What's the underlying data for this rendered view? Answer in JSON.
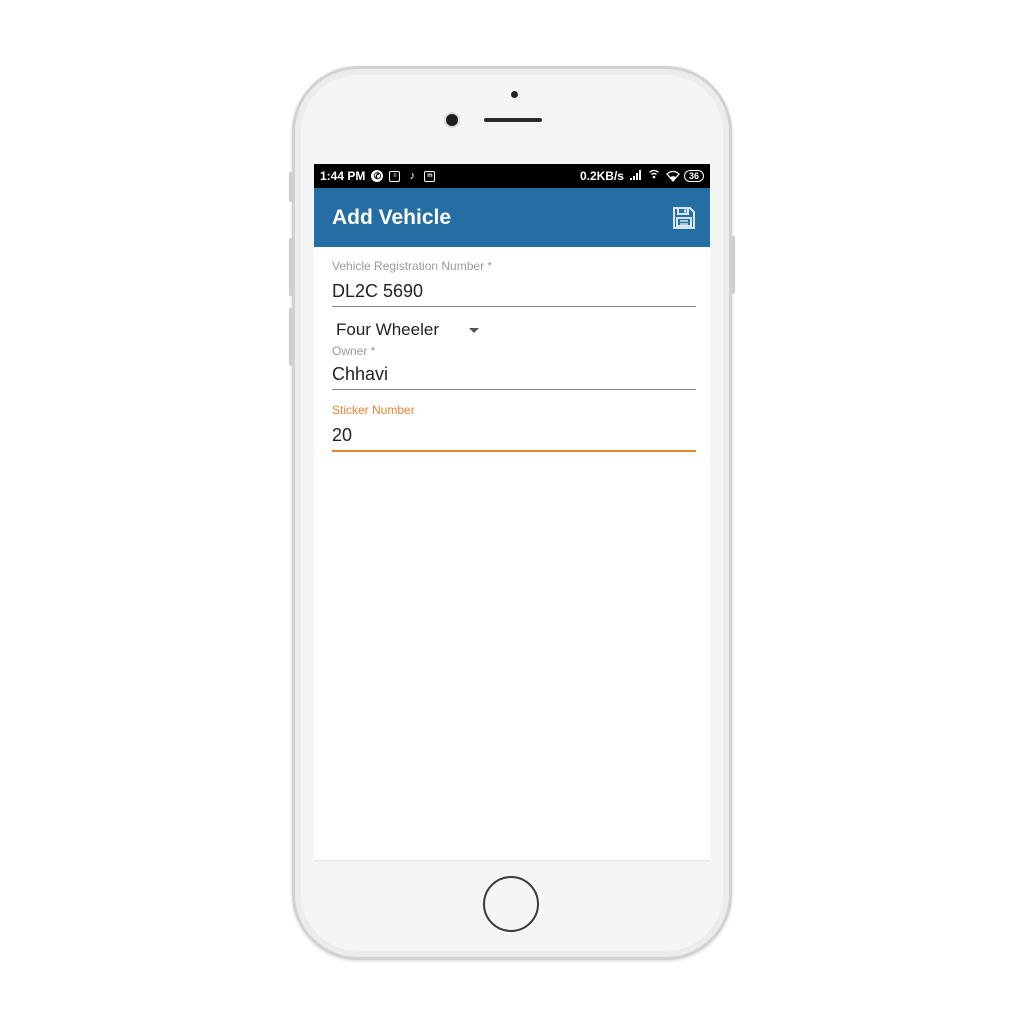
{
  "statusbar": {
    "time": "1:44 PM",
    "network_speed": "0.2KB/s",
    "battery": "36",
    "icons": [
      "whatsapp-icon",
      "message-icon",
      "tiktok-icon",
      "mi-icon",
      "signal-icon",
      "hotspot-icon",
      "wifi-icon"
    ]
  },
  "appbar": {
    "title": "Add Vehicle",
    "background": "#256ea3",
    "action_icon": "save-icon"
  },
  "form": {
    "registration": {
      "label": "Vehicle Registration Number *",
      "value": "DL2C 5690"
    },
    "vehicle_type": {
      "selected": "Four Wheeler"
    },
    "owner": {
      "label": "Owner *",
      "value": "Chhavi"
    },
    "sticker": {
      "label": "Sticker Number",
      "value": "20"
    }
  },
  "colors": {
    "accent": "#e8842f",
    "primary": "#256ea3"
  }
}
